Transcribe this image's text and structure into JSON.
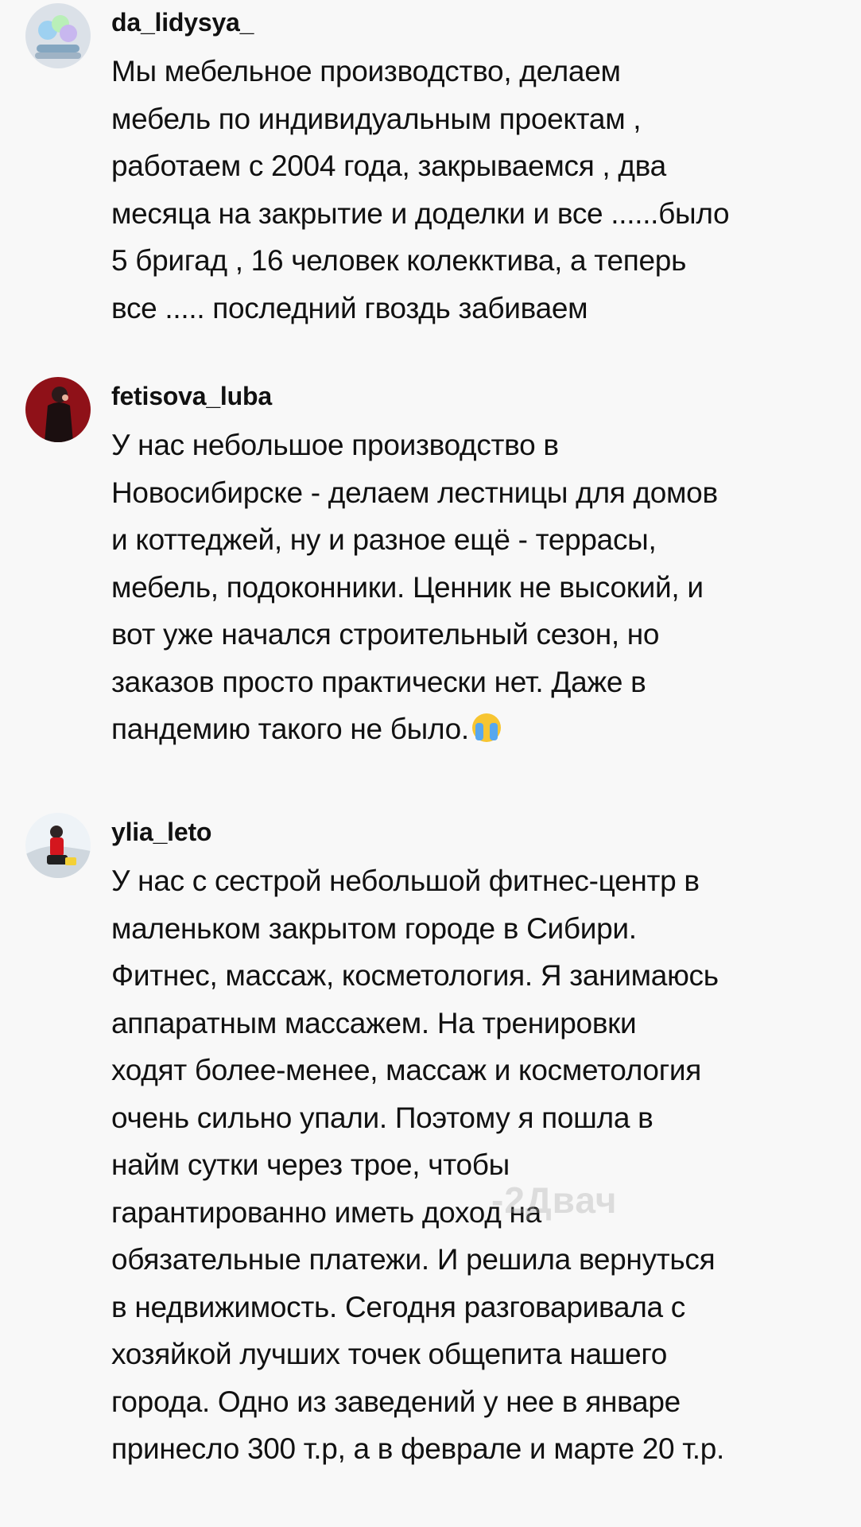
{
  "comments": [
    {
      "username": "da_lidysya_",
      "text": "Мы мебельное производство, делаем\nмебель по индивидуальным проектам ,\nработаем с 2004 года, закрываемся , два\nмесяца на закрытие и доделки и все ......было\n5 бригад , 16 человек колекктива, а теперь\nвсе ..... последний гвоздь забиваем",
      "avatar_color": "#d9e0ea"
    },
    {
      "username": "fetisova_luba",
      "text": "У нас небольшое производство в\nНовосибирске - делаем лестницы для домов\nи коттеджей, ну и разное ещё - террасы,\nмебель, подоконники. Ценник не высокий, и\nвот уже начался строительный сезон, но\nзаказов просто практически нет. Даже в\nпандемию такого не было.",
      "emoji": "loudly-crying-face",
      "avatar_color": "#8c1117"
    },
    {
      "username": "ylia_leto",
      "text": "У нас с сестрой небольшой фитнес-центр в\nмаленьком закрытом городе в Сибири.\nФитнес, массаж, косметология. Я занимаюсь\nаппаратным массажем. На тренировки\nходят более-менее, массаж и косметология\nочень сильно упали. Поэтому я пошла в\nнайм сутки через трое, чтобы\nгарантированно иметь доход на\nобязательные платежи. И решила вернуться\nв недвижимость. Сегодня разговаривала с\nхозяйкой лучших точек общепита нашего\nгорода. Одно из заведений у нее в январе\nпринесло 300 т.р, а в феврале и марте 20 т.р.",
      "avatar_color": "#eef3f7"
    }
  ],
  "watermark": "-2Двач"
}
